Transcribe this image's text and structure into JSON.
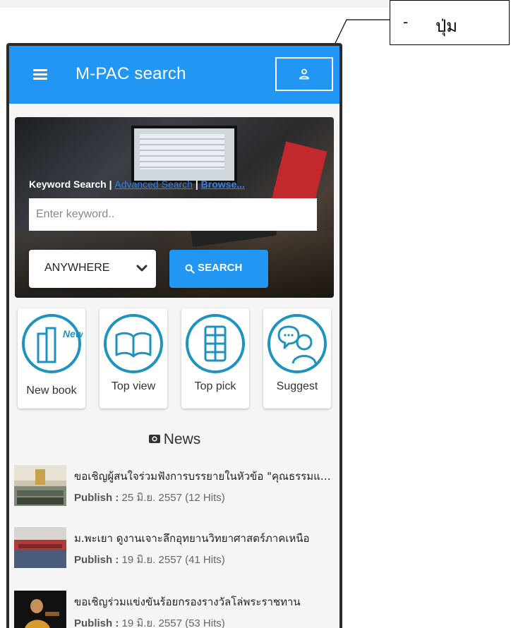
{
  "callout": {
    "dash": "-",
    "text": "ปุ่ม"
  },
  "appbar": {
    "title": "M-PAC search"
  },
  "search": {
    "tab_keyword": "Keyword Search",
    "separator": "|",
    "tab_advanced": "Advanced Search",
    "tab_browse": "Browse...",
    "placeholder": "Enter keyword..",
    "scope": "ANYWHERE",
    "button_label": "SEARCH"
  },
  "tiles": [
    {
      "label": "New book",
      "badge": "New",
      "icon": "new-book-icon"
    },
    {
      "label": "Top view",
      "icon": "open-book-icon"
    },
    {
      "label": "Top pick",
      "icon": "book-stack-icon"
    },
    {
      "label": "Suggest",
      "icon": "suggest-person-icon"
    }
  ],
  "news": {
    "heading": "News",
    "publish_label": "Publish :",
    "items": [
      {
        "title": "ขอเชิญผู้สนใจร่วมฟังการบรรยายในหัวข้อ \"คุณธรรมและจริยธรรม\"",
        "date": "25 มิ.ย. 2557 (12 Hits)"
      },
      {
        "title": "ม.พะเยา ดูงานเจาะลึกอุทยานวิทยาศาสตร์ภาคเหนือ",
        "date": "19 มิ.ย. 2557 (41 Hits)"
      },
      {
        "title": "ขอเชิญร่วมแข่งขันร้อยกรองรางวัลโล่พระราชทาน",
        "date": "19 มิ.ย. 2557 (53 Hits)"
      }
    ]
  },
  "colors": {
    "primary": "#2196f3",
    "link": "#2f80ed"
  }
}
